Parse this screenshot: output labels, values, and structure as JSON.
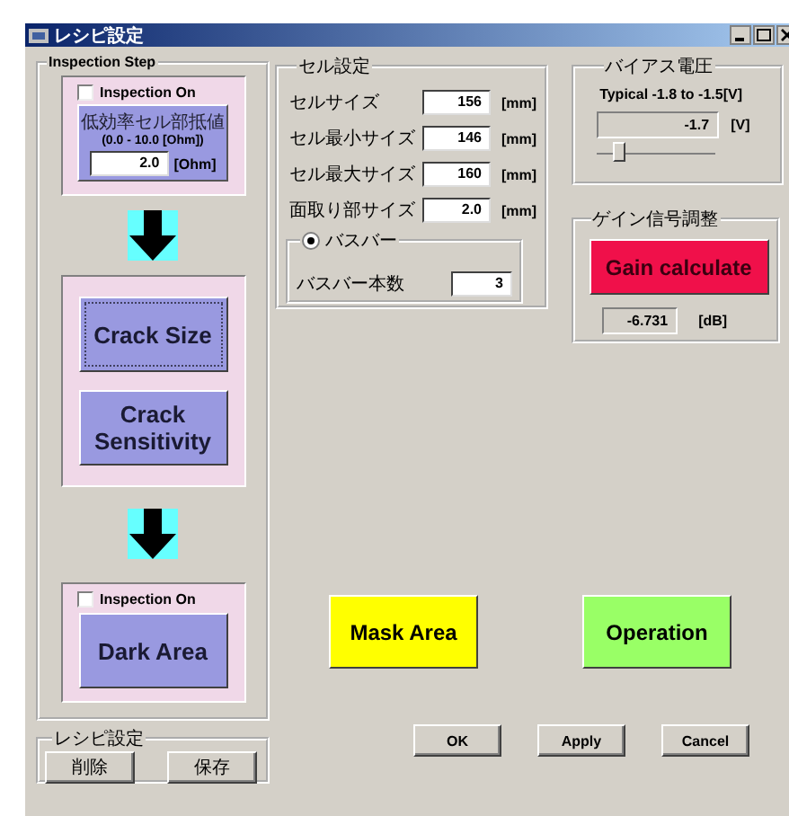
{
  "window": {
    "title": "レシピ設定"
  },
  "inspection_step": {
    "title": "Inspection Step",
    "stages": [
      {
        "kind": "resistance",
        "checkbox": {
          "label": "Inspection On",
          "checked": false
        },
        "label": "低効率セル部抵値",
        "range": "(0.0 - 10.0 [Ohm])",
        "value": "2.0",
        "unit": "[Ohm]"
      },
      {
        "kind": "buttons",
        "buttons": [
          "Crack Size",
          "Crack Sensitivity"
        ]
      },
      {
        "kind": "area",
        "checkbox": {
          "label": "Inspection On",
          "checked": false
        },
        "button": "Dark Area"
      }
    ]
  },
  "recipe": {
    "title": "レシピ設定",
    "buttons": [
      "削除",
      "保存"
    ]
  },
  "cell_settings": {
    "title": "セル設定",
    "fields": [
      {
        "label": "セルサイズ",
        "value": "156",
        "unit": "[mm]"
      },
      {
        "label": "セル最小サイズ",
        "value": "146",
        "unit": "[mm]"
      },
      {
        "label": "セル最大サイズ",
        "value": "160",
        "unit": "[mm]"
      },
      {
        "label": "面取り部サイズ",
        "value": "2.0",
        "unit": "[mm]"
      }
    ],
    "busbar": {
      "label": "バスバー",
      "selected": true,
      "count_label": "バスバー本数",
      "count": "3"
    }
  },
  "bias_voltage": {
    "title": "バイアス電圧",
    "typical": "Typical  -1.8 to -1.5[V]",
    "value": "-1.7",
    "unit": "[V]",
    "slider": {
      "level": 0.15
    }
  },
  "gain": {
    "title": "ゲイン信号調整",
    "button": "Gain calculate",
    "value": "-6.731",
    "unit": "[dB]"
  },
  "actions": [
    {
      "label": "Mask Area",
      "color": "#ffff00"
    },
    {
      "label": "Operation",
      "color": "#99ff66"
    }
  ],
  "buttons": [
    "OK",
    "Apply",
    "Cancel"
  ]
}
